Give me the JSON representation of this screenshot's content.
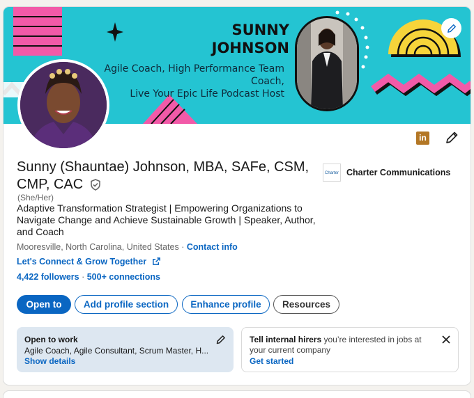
{
  "banner": {
    "name_line1": "SUNNY",
    "name_line2": "JOHNSON",
    "tagline_line1": "Agile Coach, High Performance Team Coach,",
    "tagline_line2": "Live Your Epic Life  Podcast Host"
  },
  "profile": {
    "name": "Sunny (Shauntae) Johnson, MBA, SAFe, CSM, CMP, CAC",
    "pronouns": "(She/Her)",
    "headline": "Adaptive Transformation Strategist | Empowering Organizations to Navigate Change and Achieve Sustainable Growth | Speaker, Author, and Coach",
    "location": "Mooresville, North Carolina, United States",
    "location_sep": " · ",
    "contact_info": "Contact info",
    "website": "Let's Connect & Grow Together",
    "followers": "4,422 followers",
    "connections_sep": " · ",
    "connections": "500+ connections"
  },
  "company": {
    "logo_text": "Charter",
    "name": "Charter Communications"
  },
  "actions": {
    "open_to": "Open to",
    "add_section": "Add profile section",
    "enhance": "Enhance profile",
    "resources": "Resources"
  },
  "open_to_work": {
    "title": "Open to work",
    "roles": "Agile Coach, Agile Consultant, Scrum Master, H...",
    "link": "Show details"
  },
  "hirers": {
    "bold": "Tell internal hirers",
    "text": " you’re interested in jobs at your current company",
    "link": "Get started"
  },
  "icons": {
    "linkedin_badge": "in",
    "colors": {
      "brand_blue": "#0a66c2",
      "banner_teal": "#24c4d2",
      "linkedin_gold": "#b37725"
    }
  }
}
